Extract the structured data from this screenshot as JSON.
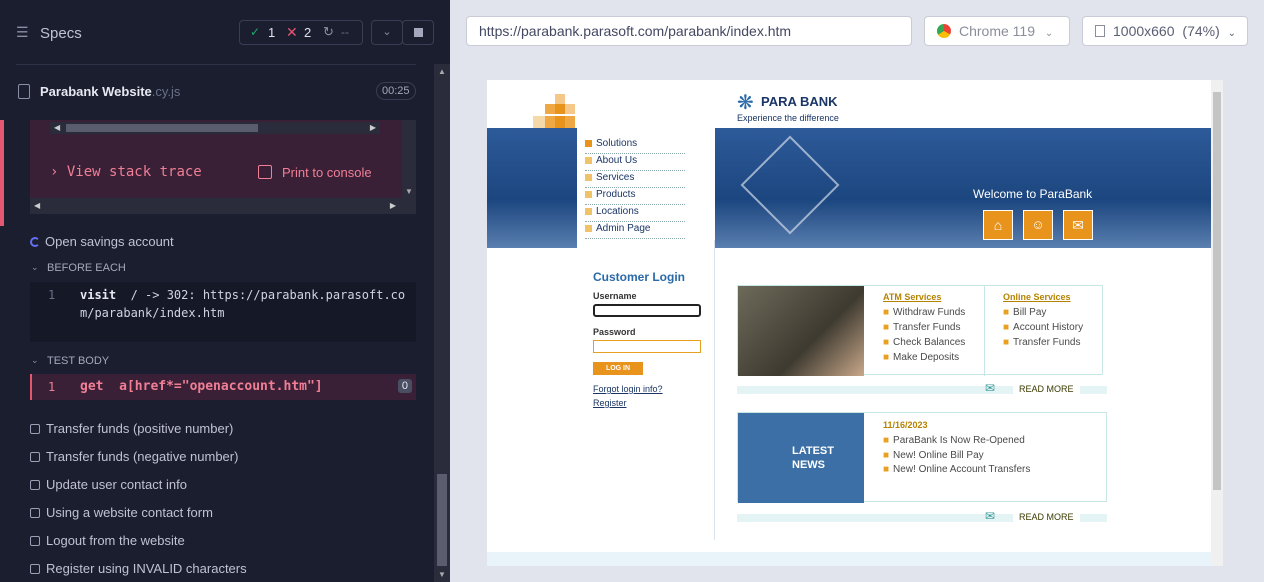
{
  "runner": {
    "header_title": "Specs",
    "pass_count": "1",
    "fail_count": "2",
    "pending_count": "--",
    "spec_name": "Parabank Website",
    "spec_ext": ".cy.js",
    "duration": "00:25",
    "stack_trace_label": "View stack trace",
    "print_console_label": "Print to console",
    "current_test": "Open savings account",
    "before_each_label": "BEFORE EACH",
    "cmd1_num": "1",
    "cmd1_name": "visit",
    "cmd1_arg": "/ -> 302: https://parabank.parasoft.com/parabank/index.htm",
    "test_body_label": "TEST BODY",
    "cmd2_num": "1",
    "cmd2_name": "get",
    "cmd2_arg": "a[href*=\"openaccount.htm\"]",
    "cmd2_badge": "0",
    "tests": [
      "Transfer funds (positive number)",
      "Transfer funds (negative number)",
      "Update user contact info",
      "Using a website contact form",
      "Logout from the website",
      "Register using INVALID characters"
    ]
  },
  "aut": {
    "url": "https://parabank.parasoft.com/parabank/index.htm",
    "browser": "Chrome 119",
    "viewport": "1000x660",
    "zoom": "(74%)"
  },
  "site": {
    "brand": "PARA BANK",
    "tagline": "Experience the difference",
    "nav": [
      "Solutions",
      "About Us",
      "Services",
      "Products",
      "Locations",
      "Admin Page"
    ],
    "welcome": "Welcome to ParaBank",
    "login_title": "Customer Login",
    "username_label": "Username",
    "password_label": "Password",
    "login_button": "LOG IN",
    "forgot_link": "Forgot login info?",
    "register_link": "Register",
    "atm_title": "ATM Services",
    "atm_items": [
      "Withdraw Funds",
      "Transfer Funds",
      "Check Balances",
      "Make Deposits"
    ],
    "online_title": "Online Services",
    "online_items": [
      "Bill Pay",
      "Account History",
      "Transfer Funds"
    ],
    "read_more": "READ MORE",
    "news_label_1": "LATEST",
    "news_label_2": "NEWS",
    "news_date": "11/16/2023",
    "news_items": [
      "ParaBank Is Now Re-Opened",
      "New! Online Bill Pay",
      "New! Online Account Transfers"
    ]
  },
  "colors": {
    "pass": "#1fa971",
    "fail": "#e45770",
    "accent": "#e8a021",
    "brand": "#1a3566"
  }
}
